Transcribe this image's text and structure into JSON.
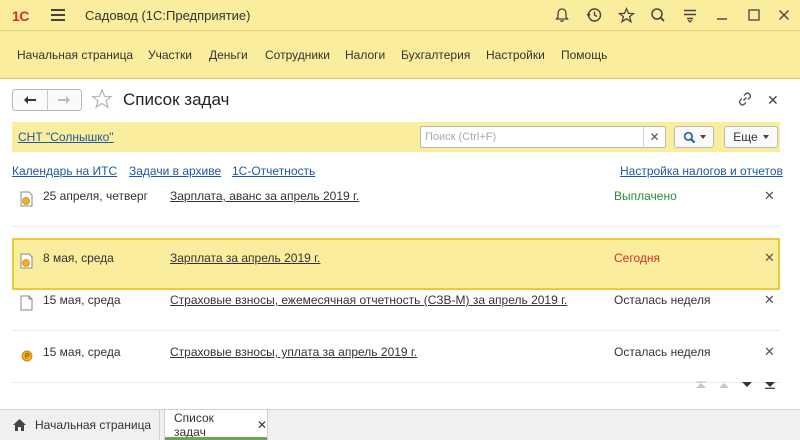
{
  "app": {
    "logo": "1С",
    "title": "Садовод  (1С:Предприятие)"
  },
  "titlebar_icons": [
    "bell-icon",
    "history-icon",
    "star-icon",
    "search-icon",
    "settings-lines-icon",
    "minimize-icon",
    "maximize-icon",
    "close-icon"
  ],
  "sections": [
    "Начальная страница",
    "Участки",
    "Деньги",
    "Сотрудники",
    "Налоги",
    "Бухгалтерия",
    "Настройки",
    "Помощь"
  ],
  "form": {
    "title": "Список задач"
  },
  "org": {
    "name": "СНТ \"Солнышко\""
  },
  "search": {
    "placeholder": "Поиск (Ctrl+F)",
    "value": ""
  },
  "toolbar": {
    "more_label": "Еще"
  },
  "quick_links": {
    "calendar": "Календарь на ИТС",
    "archive": "Задачи в архиве",
    "reporting": "1С-Отчетность",
    "tax_settings": "Настройка налогов и отчетов"
  },
  "tasks": [
    {
      "date": "25 апреля, четверг",
      "title": "Зарплата, аванс за апрель 2019 г.",
      "status": "Выплачено",
      "status_color": "#2e8b3a",
      "icon": "doc-coin-icon"
    },
    {
      "date": "8 мая, среда",
      "title": "Зарплата за апрель 2019 г.",
      "status": "Сегодня",
      "status_color": "#d0312d",
      "icon": "doc-coin-icon"
    },
    {
      "date": "15 мая, среда",
      "title": "Страховые взносы, ежемесячная отчетность (СЗВ-М) за апрель 2019 г.",
      "status": "Осталась неделя",
      "status_color": "#333333",
      "icon": "document-icon"
    },
    {
      "date": "15 мая, среда",
      "title": "Страховые взносы, уплата за апрель 2019 г.",
      "status": "Осталась неделя",
      "status_color": "#333333",
      "icon": "coin-icon"
    }
  ],
  "tabs": {
    "home": "Начальная страница",
    "active": "Список задач"
  },
  "colors": {
    "accent_yellow": "#fbed9e",
    "highlight_border": "#f0c83e",
    "link": "#1a5aa5",
    "logo_red": "#d6302a"
  }
}
